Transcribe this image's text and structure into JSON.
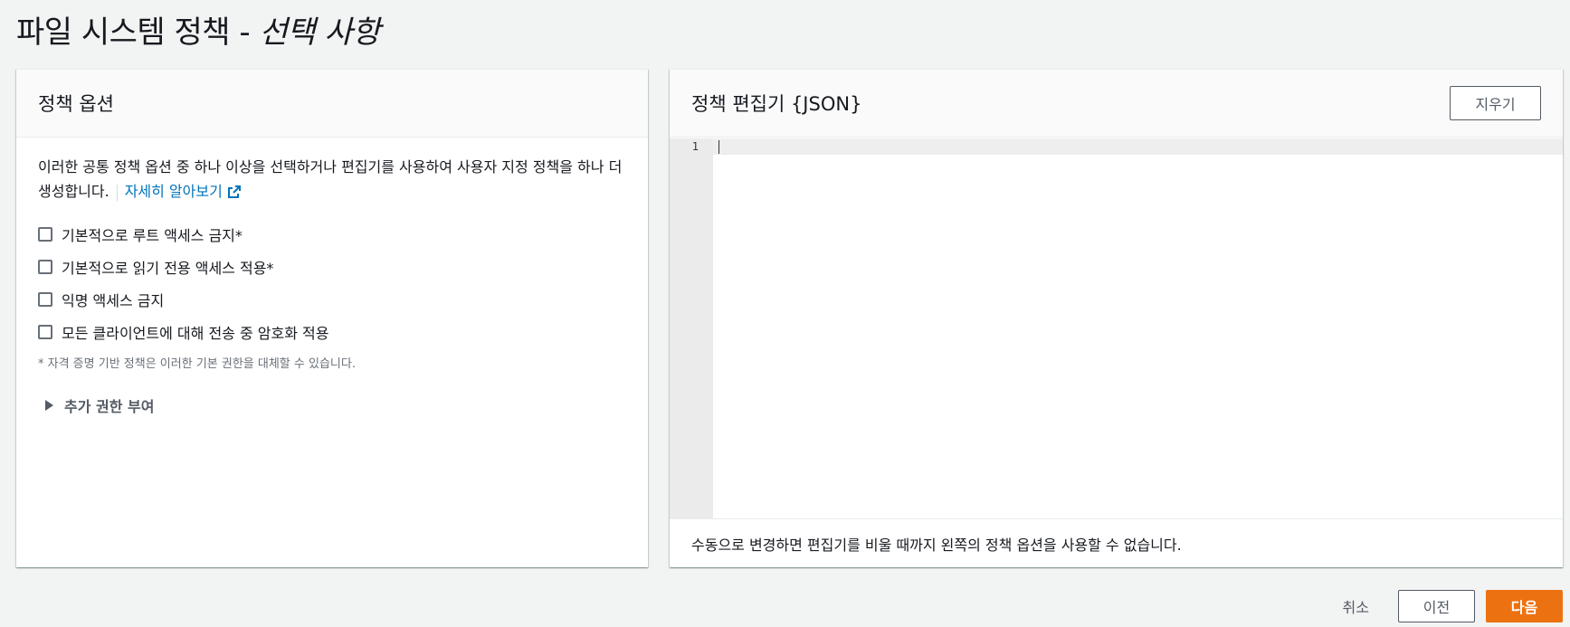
{
  "page": {
    "title_main": "파일 시스템 정책 - ",
    "title_optional": "선택 사항"
  },
  "left_panel": {
    "header": "정책 옵션",
    "description": "이러한 공통 정책 옵션 중 하나 이상을 선택하거나 편집기를 사용하여 사용자 지정 정책을 하나 더 생성합니다.",
    "learn_more": "자세히 알아보기",
    "options": [
      {
        "label": "기본적으로 루트 액세스 금지*",
        "checked": false
      },
      {
        "label": "기본적으로 읽기 전용 액세스 적용*",
        "checked": false
      },
      {
        "label": "익명 액세스 금지",
        "checked": false
      },
      {
        "label": "모든 클라이언트에 대해 전송 중 암호화 적용",
        "checked": false
      }
    ],
    "footnote": "* 자격 증명 기반 정책은 이러한 기본 권한을 대체할 수 있습니다.",
    "expand_label": "추가 권한 부여"
  },
  "right_panel": {
    "header": "정책 편집기 {JSON}",
    "clear_button": "지우기",
    "line_numbers": [
      "1"
    ],
    "footer": "수동으로 변경하면 편집기를 비울 때까지 왼쪽의 정책 옵션을 사용할 수 없습니다."
  },
  "actions": {
    "cancel": "취소",
    "previous": "이전",
    "next": "다음"
  },
  "colors": {
    "primary": "#ec7211",
    "link": "#0073bb",
    "background": "#f2f3f3"
  },
  "icons": {
    "learn_more": "external-link-icon",
    "expand": "caret-right-icon"
  }
}
